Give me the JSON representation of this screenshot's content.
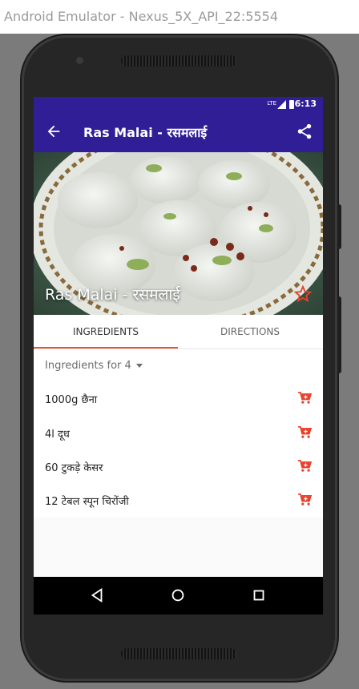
{
  "window": {
    "title": "Android Emulator - Nexus_5X_API_22:5554"
  },
  "status_bar": {
    "network": "LTE",
    "time": "6:13"
  },
  "toolbar": {
    "title": "Ras Malai - रसमलाई"
  },
  "hero": {
    "caption": "Ras Malai - रसमलाई",
    "favorite": false
  },
  "tabs": [
    {
      "label": "INGREDIENTS",
      "selected": true
    },
    {
      "label": "DIRECTIONS",
      "selected": false
    }
  ],
  "serving": {
    "label": "Ingredients for 4"
  },
  "ingredients": [
    {
      "text": "1000g छैना"
    },
    {
      "text": "4l दूध"
    },
    {
      "text": "60 टुकड़े केसर"
    },
    {
      "text": "12 टेबल स्पून चिरोंजी"
    }
  ],
  "colors": {
    "primary": "#2f1e96",
    "accent": "#e8542c",
    "cart": "#e8402c"
  },
  "icons": {
    "back": "arrow-back-icon",
    "share": "share-icon",
    "favorite": "star-outline-icon",
    "cart": "add-shopping-cart-icon",
    "nav_back": "triangle-back-icon",
    "nav_home": "circle-home-icon",
    "nav_recents": "square-recents-icon"
  }
}
